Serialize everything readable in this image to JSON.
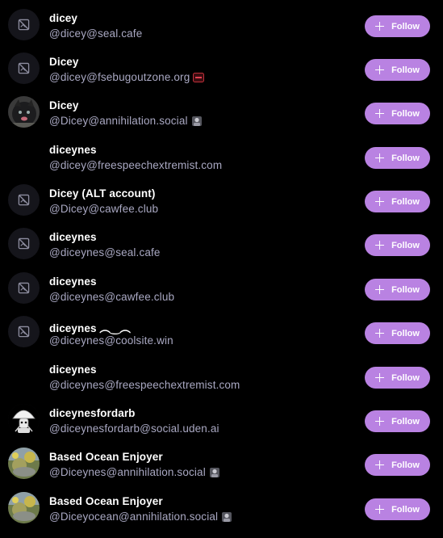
{
  "follow_label": "Follow",
  "accent_color": "#b982e2",
  "users": [
    {
      "name": "dicey",
      "handle": "@dicey@seal.cafe",
      "avatar": "placeholder",
      "emoji": null
    },
    {
      "name": "Dicey",
      "handle": "@dicey@fsebugoutzone.org",
      "avatar": "placeholder",
      "emoji": "fse-badge-emoji"
    },
    {
      "name": "Dicey",
      "handle": "@Dicey@annihilation.social",
      "avatar": "dark-cat-photo",
      "emoji": "avatar-emoji"
    },
    {
      "name": "diceynes",
      "handle": "@dicey@freespeechextremist.com",
      "avatar": "none",
      "emoji": null
    },
    {
      "name": "Dicey (ALT account)",
      "handle": "@Dicey@cawfee.club",
      "avatar": "placeholder",
      "emoji": null
    },
    {
      "name": "diceynes",
      "handle": "@diceynes@seal.cafe",
      "avatar": "placeholder",
      "emoji": null
    },
    {
      "name": "diceynes",
      "handle": "@diceynes@cawfee.club",
      "avatar": "placeholder",
      "emoji": null
    },
    {
      "name": "diceynes ︵‿︵",
      "handle": "@diceynes@coolsite.win",
      "avatar": "placeholder",
      "emoji": null
    },
    {
      "name": "diceynes",
      "handle": "@diceynes@freespeechextremist.com",
      "avatar": "none",
      "emoji": null
    },
    {
      "name": "diceynesfordarb",
      "handle": "@diceynesfordarb@social.uden.ai",
      "avatar": "mushroom-character",
      "emoji": null
    },
    {
      "name": "Based Ocean Enjoyer",
      "handle": "@Diceynes@annihilation.social",
      "avatar": "nature-photo",
      "emoji": "avatar-emoji"
    },
    {
      "name": "Based Ocean Enjoyer",
      "handle": "@Diceyocean@annihilation.social",
      "avatar": "nature-photo",
      "emoji": "avatar-emoji"
    }
  ]
}
